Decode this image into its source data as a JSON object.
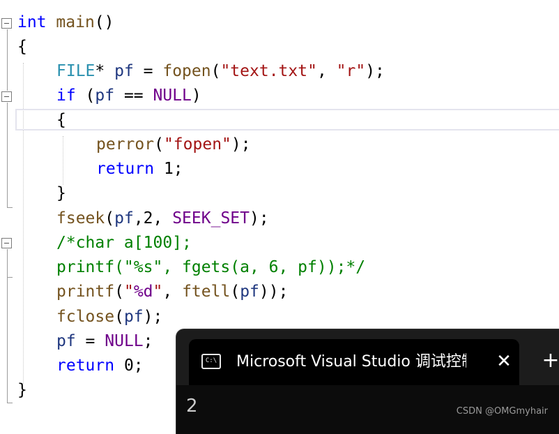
{
  "editor": {
    "lines": [
      [
        {
          "t": "int",
          "c": "kw"
        },
        {
          "t": " ",
          "c": "plain"
        },
        {
          "t": "main",
          "c": "fn"
        },
        {
          "t": "()",
          "c": "plain"
        }
      ],
      [
        {
          "t": "{",
          "c": "plain"
        }
      ],
      [
        {
          "t": "FILE",
          "c": "ty"
        },
        {
          "t": "* ",
          "c": "plain"
        },
        {
          "t": "pf",
          "c": "var"
        },
        {
          "t": " = ",
          "c": "plain"
        },
        {
          "t": "fopen",
          "c": "fn"
        },
        {
          "t": "(",
          "c": "plain"
        },
        {
          "t": "\"text.txt\"",
          "c": "str"
        },
        {
          "t": ", ",
          "c": "plain"
        },
        {
          "t": "\"r\"",
          "c": "str"
        },
        {
          "t": ");",
          "c": "plain"
        }
      ],
      [
        {
          "t": "if",
          "c": "kw"
        },
        {
          "t": " (",
          "c": "plain"
        },
        {
          "t": "pf",
          "c": "var"
        },
        {
          "t": " == ",
          "c": "plain"
        },
        {
          "t": "NULL",
          "c": "mac"
        },
        {
          "t": ")",
          "c": "plain"
        }
      ],
      [
        {
          "t": "{",
          "c": "plain"
        }
      ],
      [
        {
          "t": "perror",
          "c": "fn"
        },
        {
          "t": "(",
          "c": "plain"
        },
        {
          "t": "\"fopen\"",
          "c": "str"
        },
        {
          "t": ");",
          "c": "plain"
        }
      ],
      [
        {
          "t": "return",
          "c": "kw"
        },
        {
          "t": " 1;",
          "c": "plain"
        }
      ],
      [
        {
          "t": "}",
          "c": "plain"
        }
      ],
      [
        {
          "t": "fseek",
          "c": "fn"
        },
        {
          "t": "(",
          "c": "plain"
        },
        {
          "t": "pf",
          "c": "var"
        },
        {
          "t": ",2, ",
          "c": "plain"
        },
        {
          "t": "SEEK_SET",
          "c": "mac"
        },
        {
          "t": ");",
          "c": "plain"
        }
      ],
      [
        {
          "t": "/*char a[100];",
          "c": "cm"
        }
      ],
      [
        {
          "t": "printf(\"%s\", fgets(a, 6, pf));*/",
          "c": "cm"
        }
      ],
      [
        {
          "t": "printf",
          "c": "fn"
        },
        {
          "t": "(",
          "c": "plain"
        },
        {
          "t": "\"",
          "c": "str"
        },
        {
          "t": "%d",
          "c": "mac"
        },
        {
          "t": "\"",
          "c": "str"
        },
        {
          "t": ", ",
          "c": "plain"
        },
        {
          "t": "ftell",
          "c": "fn"
        },
        {
          "t": "(",
          "c": "plain"
        },
        {
          "t": "pf",
          "c": "var"
        },
        {
          "t": "));",
          "c": "plain"
        }
      ],
      [
        {
          "t": "fclose",
          "c": "fn"
        },
        {
          "t": "(",
          "c": "plain"
        },
        {
          "t": "pf",
          "c": "var"
        },
        {
          "t": ");",
          "c": "plain"
        }
      ],
      [
        {
          "t": "pf",
          "c": "var"
        },
        {
          "t": " = ",
          "c": "plain"
        },
        {
          "t": "NULL",
          "c": "mac"
        },
        {
          "t": ";",
          "c": "plain"
        }
      ],
      [
        {
          "t": "return",
          "c": "kw"
        },
        {
          "t": " 0;",
          "c": "plain"
        }
      ],
      [
        {
          "t": "}",
          "c": "plain"
        }
      ]
    ]
  },
  "console": {
    "icon_glyph": "C:\\",
    "tab_title": "Microsoft Visual Studio 调试控制台",
    "close_glyph": "✕",
    "new_tab_glyph": "+",
    "output": "2"
  },
  "watermark": "CSDN @OMGmyhair"
}
